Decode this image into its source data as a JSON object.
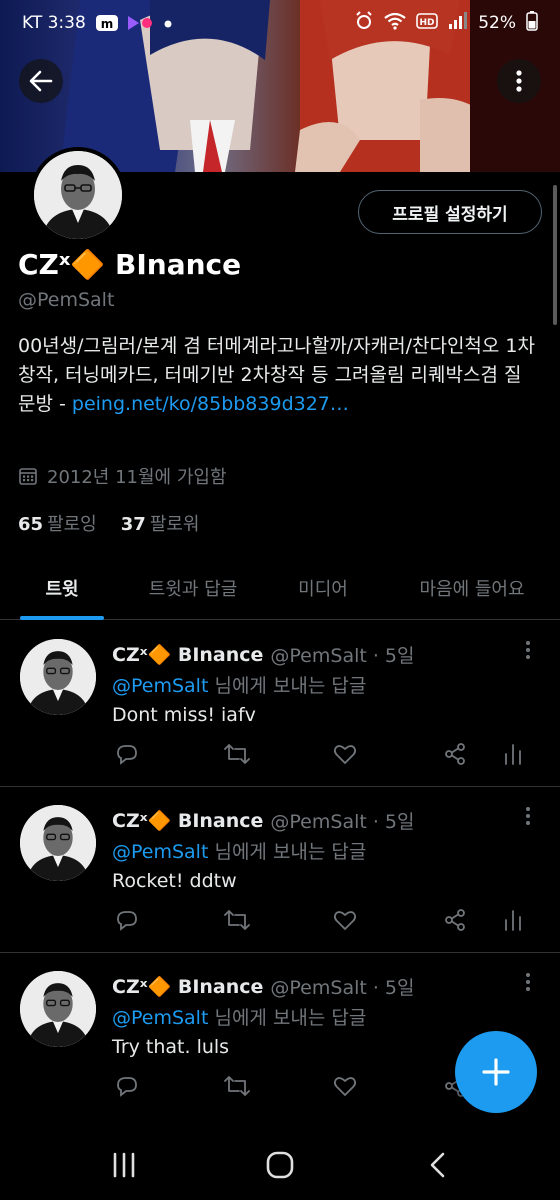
{
  "status_bar": {
    "carrier_time": "KT 3:38",
    "battery": "52%"
  },
  "profile": {
    "display_name": "CZˣ🔶 BInance",
    "handle": "@PemSalt",
    "edit_button": "프로필 설정하기",
    "bio_text": "00년생/그림러/본계 겸 터메계라고나할까/자캐러/찬다인척오 1차창작, 터닝메카드, 터메기반 2차창작 등 그려올림 리퀘박스겸 질문방 - ",
    "bio_link": "peing.net/ko/85bb839d327…",
    "joined": "2012년 11월에 가입함",
    "following_count": "65",
    "following_label": "팔로잉",
    "followers_count": "37",
    "followers_label": "팔로워"
  },
  "tabs": [
    "트윗",
    "트윗과 답글",
    "미디어",
    "마음에 들어요"
  ],
  "tweets": [
    {
      "name": "CZˣ🔶 BInance",
      "handle": "@PemSalt · 5일",
      "reply_mention": "@PemSalt",
      "reply_suffix": " 님에게 보내는 답글",
      "text": "Dont miss! iafv"
    },
    {
      "name": "CZˣ🔶 BInance",
      "handle": "@PemSalt · 5일",
      "reply_mention": "@PemSalt",
      "reply_suffix": " 님에게 보내는 답글",
      "text": "Rocket! ddtw"
    },
    {
      "name": "CZˣ🔶 BInance",
      "handle": "@PemSalt · 5일",
      "reply_mention": "@PemSalt",
      "reply_suffix": " 님에게 보내는 답글",
      "text": "Try that. luls"
    }
  ],
  "colors": {
    "accent": "#1d9bf0",
    "background": "#000000",
    "muted_text": "#71767b",
    "divider": "#2f3336"
  },
  "icons": {
    "back": "arrow-left-icon",
    "more": "more-vertical-icon",
    "calendar": "calendar-icon",
    "reply": "reply-icon",
    "retweet": "retweet-icon",
    "like": "heart-icon",
    "share": "share-icon",
    "analytics": "analytics-icon",
    "compose": "plus-icon"
  }
}
